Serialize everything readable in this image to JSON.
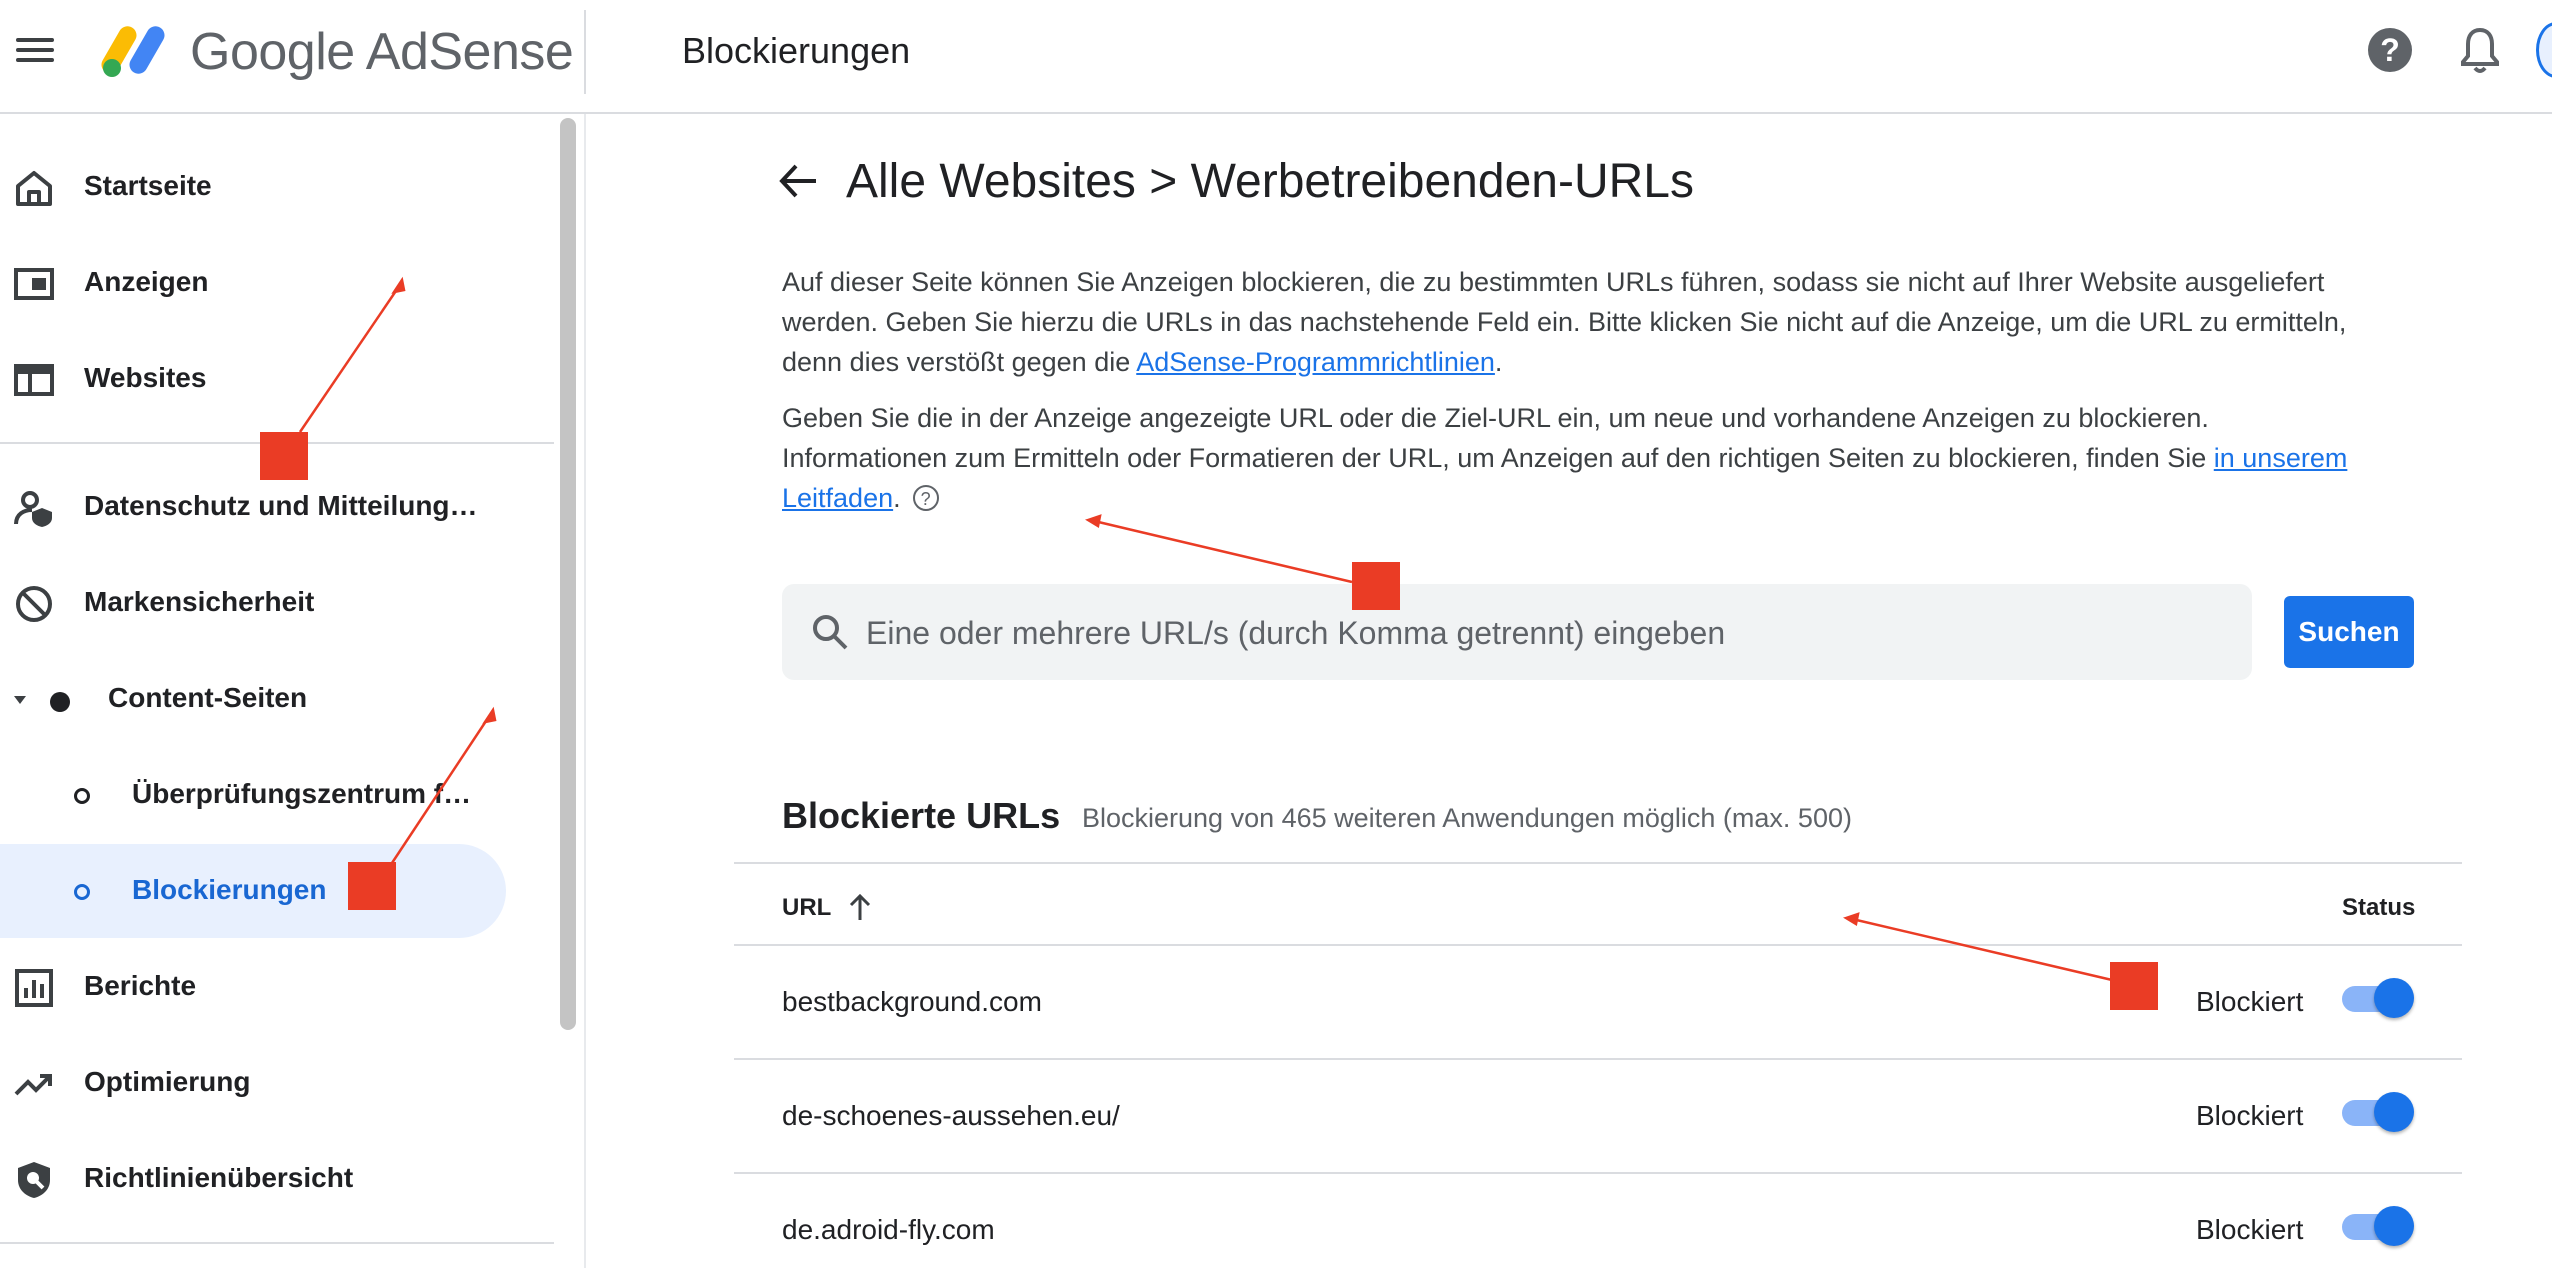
{
  "header": {
    "brand": "Google AdSense",
    "page_heading": "Blockierungen",
    "help_symbol": "?"
  },
  "sidebar": {
    "items": [
      {
        "label": "Startseite",
        "icon": "home-icon"
      },
      {
        "label": "Anzeigen",
        "icon": "ads-icon"
      },
      {
        "label": "Websites",
        "icon": "sites-icon"
      },
      {
        "label": "Datenschutz und Mitteilung…",
        "icon": "privacy-icon"
      },
      {
        "label": "Markensicherheit",
        "icon": "block-icon"
      },
      {
        "label": "Content-Seiten",
        "icon": "dot-icon"
      },
      {
        "label": "Überprüfungszentrum f…",
        "icon": "circle-icon"
      },
      {
        "label": "Blockierungen",
        "icon": "circle-icon"
      },
      {
        "label": "Berichte",
        "icon": "reports-icon"
      },
      {
        "label": "Optimierung",
        "icon": "trending-icon"
      },
      {
        "label": "Richtlinienübersicht",
        "icon": "policy-shield-icon"
      }
    ]
  },
  "main": {
    "title": "Alle Websites > Werbetreibenden-URLs",
    "para1_text": "Auf dieser Seite können Sie Anzeigen blockieren, die zu bestimmten URLs führen, sodass sie nicht auf Ihrer Website ausgeliefert werden. Geben Sie hierzu die URLs in das nachstehende Feld ein. Bitte klicken Sie nicht auf die Anzeige, um die URL zu ermitteln, denn dies verstößt gegen die ",
    "para1_link": "AdSense-Programmrichtlinien",
    "para1_end": ".",
    "para2_text": "Geben Sie die in der Anzeige angezeigte URL oder die Ziel-URL ein, um neue und vorhandene Anzeigen zu blockieren. Informationen zum Ermitteln oder Formatieren der URL, um Anzeigen auf den richtigen Seiten zu blockieren, finden Sie ",
    "para2_link": "in unserem Leitfaden",
    "para2_end": ".",
    "para2_help": "?",
    "search": {
      "placeholder": "Eine oder mehrere URL/s (durch Komma getrennt) eingeben",
      "value": ""
    },
    "search_button": "Suchen",
    "blocked": {
      "title": "Blockierte URLs",
      "subtitle": "Blockierung von 465 weiteren Anwendungen möglich (max. 500)",
      "col_url": "URL",
      "col_status": "Status",
      "rows": [
        {
          "url": "bestbackground.com",
          "status": "Blockiert",
          "toggle_on": true
        },
        {
          "url": "de-schoenes-aussehen.eu/",
          "status": "Blockiert",
          "toggle_on": true
        },
        {
          "url": "de.adroid-fly.com",
          "status": "Blockiert",
          "toggle_on": true
        }
      ]
    }
  },
  "colors": {
    "accent": "#1a73e8",
    "active_nav_bg": "#e8f0fe",
    "annotation_red": "#ea3c25"
  }
}
